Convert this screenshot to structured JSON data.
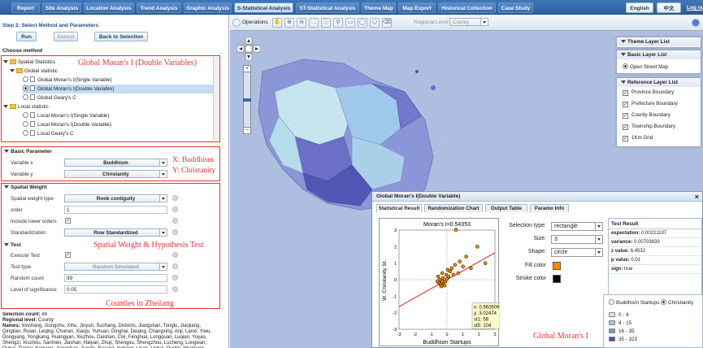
{
  "nav": {
    "tabs": [
      "Report",
      "Site Analysis",
      "Location Analysis",
      "Trend Analysis",
      "Graphic Analysis",
      "S-Statistical Analysis",
      "ST-Statistical Analysis",
      "Theme Map",
      "Map Export",
      "Historical Collection",
      "Case Study"
    ],
    "active_tab": "S-Statistical Analysis",
    "lang_en": "English",
    "lang_zh": "中文",
    "logout": "Log out"
  },
  "left": {
    "step_title": "Step 2: Select Method and Parameters",
    "run_label": "Run",
    "cancel_label": "Cancel",
    "back_label": "Back to Selection",
    "choose_method": "Choose method",
    "tree": {
      "spatial_statistics": "Spatial Statistics",
      "global_statistic": "Global statistic",
      "global_moran_single": "Global Moran's I(Single Variable)",
      "global_moran_double": "Global Moran's I(Double Variable)",
      "global_geary": "Global Geary's C",
      "local_statistic": "Local statistic",
      "local_moran_single": "Local Moran's I(Single Variable)",
      "local_moran_double": "Local Moran's I(Double Variable)",
      "local_geary": "Local Geary's C"
    },
    "basic": {
      "header": "Basic Parameter",
      "var_x_label": "Variable x",
      "var_x": "Buddhism",
      "var_y_label": "Variable y",
      "var_y": "Christanity"
    },
    "weight": {
      "header": "Spatial Weight",
      "type_label": "Spatial weight type",
      "type": "Rook contiguity",
      "order_label": "order",
      "order": "1",
      "include_lower_label": "Include lower orders",
      "include_lower": true,
      "standardization_label": "Standardization",
      "standardization": "Row Standardized"
    },
    "test": {
      "header": "Test",
      "execute_label": "Execute Test",
      "execute": true,
      "type_label": "Test type",
      "type": "Random Simulated",
      "random_label": "Random count",
      "random": "99",
      "sig_label": "Level of significance",
      "sig": "0.05"
    },
    "selection": {
      "count_label": "Selection count:",
      "count": "89",
      "level_label": "Regional level:",
      "level": "County",
      "names_label": "Names:",
      "names": "Xinchang, Gongshu, Xihu, Jinyun, Suchang, Districts, Jiangshan, Tonglu, Jiaojiang, Qingtian, Ruian, Leqing, Chunan, Xiaoju, Yuhuan, Dinghai, Deqing, Changxing, Anji, Lanxi, Yiwu, Dongyang, Yongkang, Huangyan, Xiuzhou, Daishan, Cixi, Fenghua, Longquan, Luqiao, Yuyao, Shengzi, Xiuzhou, Sanmen, Jiashan, Haiyan, Zhuji, Shengxu, Shengzhou, Lucheng, Longwan, Ouhai, Tiantai, Keqiang, Jiangshan, Jiande, Fuyang, Yuhang, Linan, Linhai, Qunlin, Wucheng, Keihua, Longyou, Dongtou, Yongjia,"
    }
  },
  "annotations": {
    "global_moran": "Global Moran's I (Double Variables)",
    "x_buddhism": "X: Buddhism",
    "y_christianity": "Y: Christanity",
    "spatial_weight": "Spatial Weight & Hypothesis Test",
    "counties": "Counties in Zheiiang",
    "global_moran_short": "Global Moran's I"
  },
  "map": {
    "operations_label": "Operations",
    "regional_level_label": "Regional",
    "level_label": "Level",
    "level_value": "County",
    "theme_layer_list": "Theme Layer List",
    "basic_layer_list": "Basic Layer List",
    "basic_layers": [
      "Open Street Map"
    ],
    "reference_layer_list": "Reference Layer List",
    "reference_layers": [
      "Province Boundary",
      "Prefecture Boundary",
      "County Boundary",
      "Township Boundary",
      "1Km Grid"
    ]
  },
  "dialog": {
    "title": "Global Moran's I(Double Variable)",
    "tabs": [
      "Statistical Result",
      "Randomization Chart",
      "Output Table",
      "Paramo Info"
    ],
    "active_tab": "Statistical Result",
    "selection_type_label": "Selection type:",
    "selection_type": "rectangle",
    "size_label": "Size:",
    "size": "3",
    "shape_label": "Shape:",
    "shape": "circle",
    "fill_color_label": "Fill  color",
    "fill_color": "#f08c00",
    "stroke_color_label": "Stroke color",
    "stroke_color": "#000000",
    "test_result_header": "Test Result",
    "results": [
      {
        "k": "expectation:",
        "v": "0.00221107"
      },
      {
        "k": "variance:",
        "v": "0.00703639"
      },
      {
        "k": "z value:",
        "v": "6.4532"
      },
      {
        "k": "p value:",
        "v": "0.01"
      },
      {
        "k": "sign:",
        "v": "true"
      }
    ]
  },
  "legend": {
    "option1": "Buddhism Startups",
    "option2": "Christianity",
    "classes": [
      {
        "label": "0 - 4",
        "color": "#c8e8ee"
      },
      {
        "label": "4 - 15",
        "color": "#9ec6ea"
      },
      {
        "label": "16 - 35",
        "color": "#7f8fd8"
      },
      {
        "label": "35 - 323",
        "color": "#4a4db0"
      }
    ]
  },
  "chart_data": {
    "type": "scatter",
    "title": "Moran's I=0.54353",
    "xlabel": "Buddhism Startups",
    "ylabel": "W. Christanity St..",
    "xlim": [
      -3,
      3
    ],
    "ylim": [
      -3,
      3
    ],
    "xticks": [
      "-3",
      "-2",
      "-1",
      "0",
      "1",
      "2",
      "3"
    ],
    "yticks": [
      "3",
      "2",
      "1",
      "0",
      "-1",
      "-2",
      "-3"
    ],
    "regression_slope": 0.54353,
    "points": [
      {
        "x": -0.5,
        "y": -0.2
      },
      {
        "x": -0.4,
        "y": -0.3
      },
      {
        "x": -0.3,
        "y": -0.1
      },
      {
        "x": -0.45,
        "y": 0.0
      },
      {
        "x": -0.35,
        "y": -0.4
      },
      {
        "x": -0.2,
        "y": -0.25
      },
      {
        "x": -0.25,
        "y": 0.1
      },
      {
        "x": -0.1,
        "y": -0.1
      },
      {
        "x": -0.15,
        "y": -0.35
      },
      {
        "x": 0.0,
        "y": 0.05
      },
      {
        "x": 0.1,
        "y": 0.2
      },
      {
        "x": -0.05,
        "y": 0.3
      },
      {
        "x": 0.2,
        "y": 0.5
      },
      {
        "x": 0.3,
        "y": 0.7
      },
      {
        "x": 0.4,
        "y": 0.3
      },
      {
        "x": 0.5,
        "y": 0.9
      },
      {
        "x": 0.56,
        "y": 3.02
      },
      {
        "x": 0.8,
        "y": 1.1
      },
      {
        "x": 1.0,
        "y": 0.8
      },
      {
        "x": 1.2,
        "y": 1.4
      },
      {
        "x": 1.5,
        "y": 0.7
      },
      {
        "x": 1.9,
        "y": 2.0
      },
      {
        "x": 2.4,
        "y": 1.0
      },
      {
        "x": -0.55,
        "y": 0.2
      },
      {
        "x": -0.6,
        "y": -0.1
      },
      {
        "x": 0.05,
        "y": 0.6
      },
      {
        "x": -0.3,
        "y": 0.4
      },
      {
        "x": 0.7,
        "y": 0.4
      }
    ],
    "tooltip": [
      "x: 0.562609",
      "y: 3.02474",
      "st1: 58",
      "st5: 104"
    ]
  }
}
